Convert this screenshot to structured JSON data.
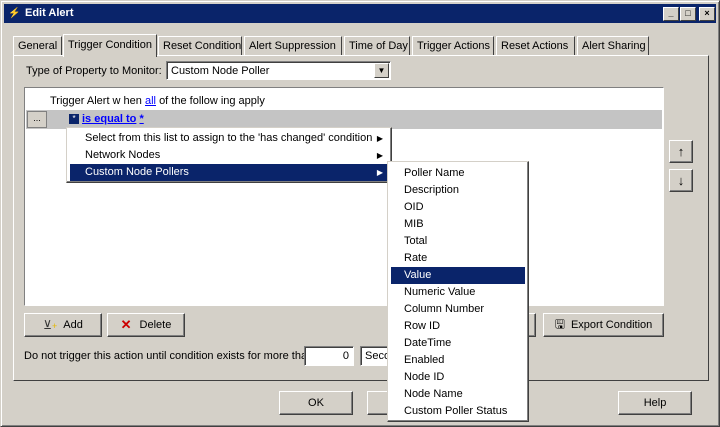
{
  "window": {
    "title": "Edit Alert"
  },
  "tabs": [
    {
      "label": "General"
    },
    {
      "label": "Trigger Condition"
    },
    {
      "label": "Reset Condition"
    },
    {
      "label": "Alert Suppression"
    },
    {
      "label": "Time of Day"
    },
    {
      "label": "Trigger Actions"
    },
    {
      "label": "Reset Actions"
    },
    {
      "label": "Alert Sharing"
    }
  ],
  "active_tab": "Trigger Condition",
  "property": {
    "label": "Type of Property to Monitor:",
    "value": "Custom Node Poller"
  },
  "condition": {
    "trigger_prefix": "Trigger Alert w hen",
    "trigger_link": "all",
    "trigger_suffix": "of the follow ing apply",
    "dots": "...",
    "operator": "is equal to",
    "value": "*"
  },
  "context_menu": [
    {
      "label": "Select from this list to assign to the 'has changed' condition"
    },
    {
      "label": "Network Nodes"
    },
    {
      "label": "Custom Node Pollers",
      "selected": true
    }
  ],
  "submenu": [
    {
      "label": "Poller Name"
    },
    {
      "label": "Description"
    },
    {
      "label": "OID"
    },
    {
      "label": "MIB"
    },
    {
      "label": "Total"
    },
    {
      "label": "Rate"
    },
    {
      "label": "Value",
      "selected": true
    },
    {
      "label": "Numeric Value"
    },
    {
      "label": "Column Number"
    },
    {
      "label": "Row ID"
    },
    {
      "label": "DateTime"
    },
    {
      "label": "Enabled"
    },
    {
      "label": "Node ID"
    },
    {
      "label": "Node Name"
    },
    {
      "label": "Custom Poller Status"
    }
  ],
  "buttons": {
    "add": "Add",
    "delete": "Delete",
    "export": "Export Condition",
    "ok": "OK",
    "help": "Help"
  },
  "delay": {
    "label": "Do not trigger this action until condition exists for more than",
    "value": "0",
    "unit": "Seco"
  }
}
